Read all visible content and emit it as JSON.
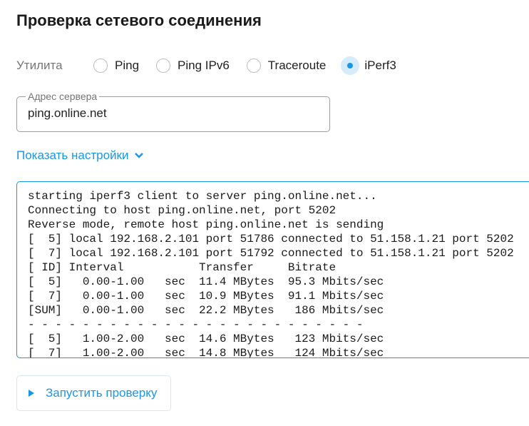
{
  "title": "Проверка сетевого соединения",
  "utility": {
    "label": "Утилита",
    "options": [
      "Ping",
      "Ping IPv6",
      "Traceroute",
      "iPerf3"
    ],
    "selected": "iPerf3"
  },
  "server": {
    "label": "Адрес сервера",
    "value": "ping.online.net"
  },
  "settings_toggle": "Показать настройки",
  "output_lines": [
    "starting iperf3 client to server ping.online.net...",
    "Connecting to host ping.online.net, port 5202",
    "Reverse mode, remote host ping.online.net is sending",
    "[  5] local 192.168.2.101 port 51786 connected to 51.158.1.21 port 5202",
    "[  7] local 192.168.2.101 port 51792 connected to 51.158.1.21 port 5202",
    "[ ID] Interval           Transfer     Bitrate",
    "[  5]   0.00-1.00   sec  11.4 MBytes  95.3 Mbits/sec",
    "[  7]   0.00-1.00   sec  10.9 MBytes  91.1 Mbits/sec",
    "[SUM]   0.00-1.00   sec  22.2 MBytes   186 Mbits/sec",
    "- - - - - - - - - - - - - - - - - - - - - - - - -",
    "[  5]   1.00-2.00   sec  14.6 MBytes   123 Mbits/sec",
    "[  7]   1.00-2.00   sec  14.8 MBytes   124 Mbits/sec"
  ],
  "run_button": "Запустить проверку"
}
